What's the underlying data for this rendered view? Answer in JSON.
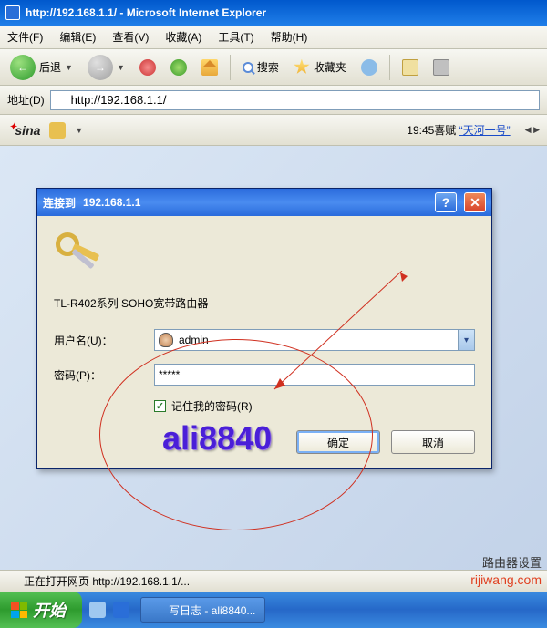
{
  "window": {
    "title": "http://192.168.1.1/ - Microsoft Internet Explorer"
  },
  "menubar": {
    "file": "文件(F)",
    "edit": "编辑(E)",
    "view": "查看(V)",
    "favorites": "收藏(A)",
    "tools": "工具(T)",
    "help": "帮助(H)"
  },
  "toolbar": {
    "back": "后退",
    "search": "搜索",
    "favorites": "收藏夹"
  },
  "addressbar": {
    "label": "地址(D)",
    "url": "http://192.168.1.1/"
  },
  "sinabar": {
    "ticker_time": "19:45",
    "ticker_prefix": "喜赋",
    "ticker_link": "“天河一号”"
  },
  "dialog": {
    "title_prefix": "连接到",
    "title_host": "192.168.1.1",
    "description": "TL-R402系列 SOHO宽带路由器",
    "username_label": "用户名(U)：",
    "username_value": "admin",
    "password_label": "密码(P)：",
    "password_value": "*****",
    "remember_label": "记住我的密码(R)",
    "ok": "确定",
    "cancel": "取消"
  },
  "watermark_text": "ali8840",
  "statusbar": {
    "text": "正在打开网页 http://192.168.1.1/..."
  },
  "taskbar": {
    "start": "开始",
    "task1": "写日志 - ali8840..."
  },
  "corner_watermark": {
    "line1": "路由器设置",
    "line2": "rijiwang.com"
  }
}
